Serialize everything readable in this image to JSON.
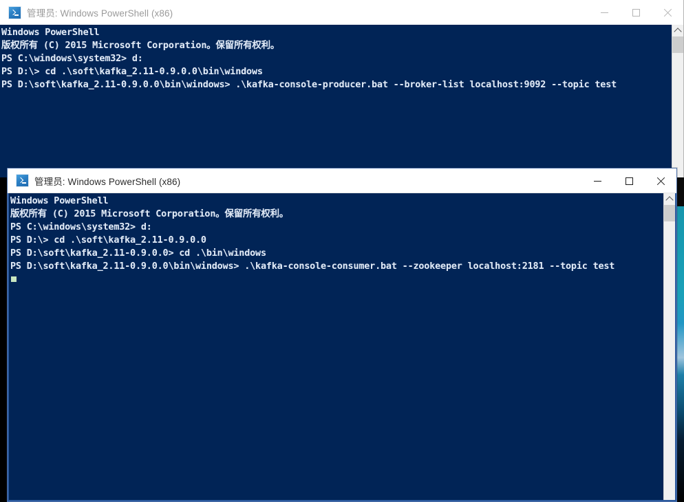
{
  "desktop": {
    "background_color": "#000000",
    "accent_strip_color": "#1796ad"
  },
  "windows": [
    {
      "id": "producer",
      "active": false,
      "title": "管理员: Windows PowerShell (x86)",
      "icon": "powershell-icon",
      "controls": {
        "minimize_label": "最小化",
        "maximize_label": "最大化",
        "close_label": "关闭"
      },
      "console": {
        "background_color": "#012456",
        "foreground_color": "#dfe8f5",
        "lines": [
          "Windows PowerShell",
          "版权所有 (C) 2015 Microsoft Corporation。保留所有权利。",
          "",
          "PS C:\\windows\\system32> d:",
          "PS D:\\> cd .\\soft\\kafka_2.11-0.9.0.0\\bin\\windows",
          "PS D:\\soft\\kafka_2.11-0.9.0.0\\bin\\windows> .\\kafka-console-producer.bat --broker-list localhost:9092 --topic test"
        ],
        "cursor_visible": false
      },
      "scrollbar": {
        "visible": true,
        "up_arrow": "▲",
        "thumb_position": "top"
      }
    },
    {
      "id": "consumer",
      "active": true,
      "title": "管理员: Windows PowerShell (x86)",
      "icon": "powershell-icon",
      "controls": {
        "minimize_label": "最小化",
        "maximize_label": "最大化",
        "close_label": "关闭"
      },
      "console": {
        "background_color": "#012456",
        "foreground_color": "#dfe8f5",
        "lines": [
          "Windows PowerShell",
          "版权所有 (C) 2015 Microsoft Corporation。保留所有权利。",
          "",
          "PS C:\\windows\\system32> d:",
          "PS D:\\> cd .\\soft\\kafka_2.11-0.9.0.0",
          "PS D:\\soft\\kafka_2.11-0.9.0.0> cd .\\bin\\windows",
          "PS D:\\soft\\kafka_2.11-0.9.0.0\\bin\\windows> .\\kafka-console-consumer.bat --zookeeper localhost:2181 --topic test"
        ],
        "cursor_visible": true,
        "cursor_color": "#c8e6c0"
      },
      "scrollbar": {
        "visible": true,
        "up_arrow": "▲",
        "thumb_position": "top"
      }
    }
  ]
}
